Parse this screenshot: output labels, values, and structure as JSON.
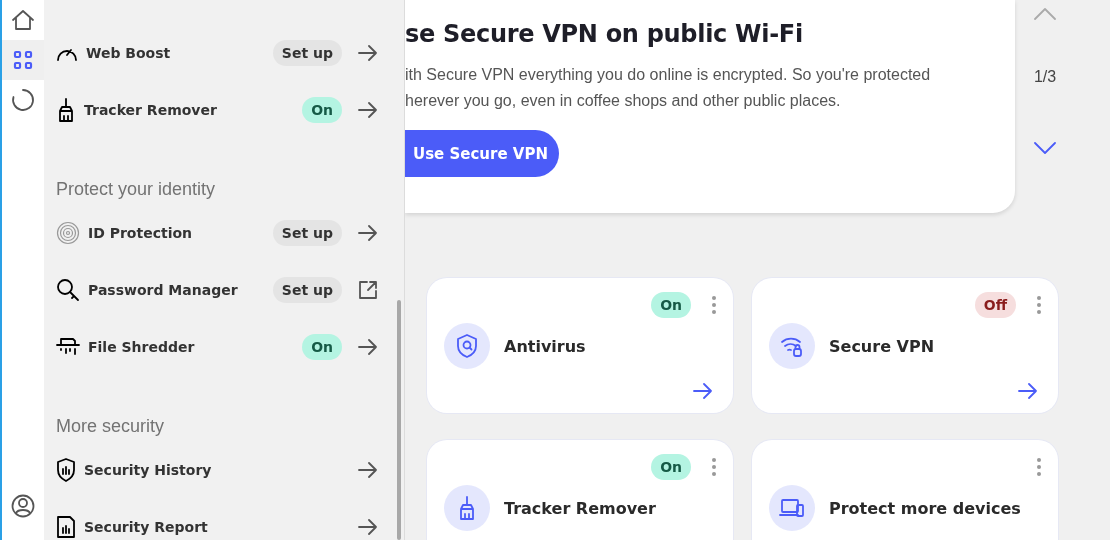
{
  "rail": {
    "items": [
      {
        "kind": "home",
        "selected": false
      },
      {
        "kind": "apps",
        "selected": true
      },
      {
        "kind": "progress",
        "selected": false
      }
    ],
    "account": {
      "kind": "account"
    }
  },
  "menu": {
    "sections": [
      {
        "items": [
          {
            "label": "Web Boost",
            "status": {
              "text": "Set up",
              "kind": "setup"
            },
            "kind": "arrow"
          },
          {
            "label": "Tracker Remover",
            "status": {
              "text": "On",
              "kind": "on"
            },
            "kind": "arrow"
          }
        ]
      },
      {
        "header": "Protect your identity",
        "items": [
          {
            "label": "ID Protection",
            "status": {
              "text": "Set up",
              "kind": "setup"
            },
            "kind": "arrow"
          },
          {
            "label": "Password Manager",
            "status": {
              "text": "Set up",
              "kind": "setup"
            },
            "kind": "external"
          },
          {
            "label": "File Shredder",
            "status": {
              "text": "On",
              "kind": "on"
            },
            "kind": "arrow"
          }
        ]
      },
      {
        "header": "More security",
        "items": [
          {
            "label": "Security History",
            "kind": "arrow"
          },
          {
            "label": "Security Report",
            "kind": "arrow"
          }
        ]
      }
    ]
  },
  "banner": {
    "title": "se Secure VPN on public Wi-Fi",
    "lines": [
      "ith Secure VPN everything you do online is encrypted. So you're protected",
      "herever you go, even in coffee shops and other public places."
    ],
    "button": "Use Secure VPN",
    "pager": "1/3"
  },
  "cards": [
    {
      "title": "Antivirus",
      "status": {
        "text": "On",
        "kind": "on"
      },
      "arrow": true
    },
    {
      "title": "Secure VPN",
      "status": {
        "text": "Off",
        "kind": "off"
      },
      "arrow": true
    },
    {
      "title": "Tracker Remover",
      "status": {
        "text": "On",
        "kind": "on"
      }
    },
    {
      "title": "Protect more devices"
    }
  ]
}
